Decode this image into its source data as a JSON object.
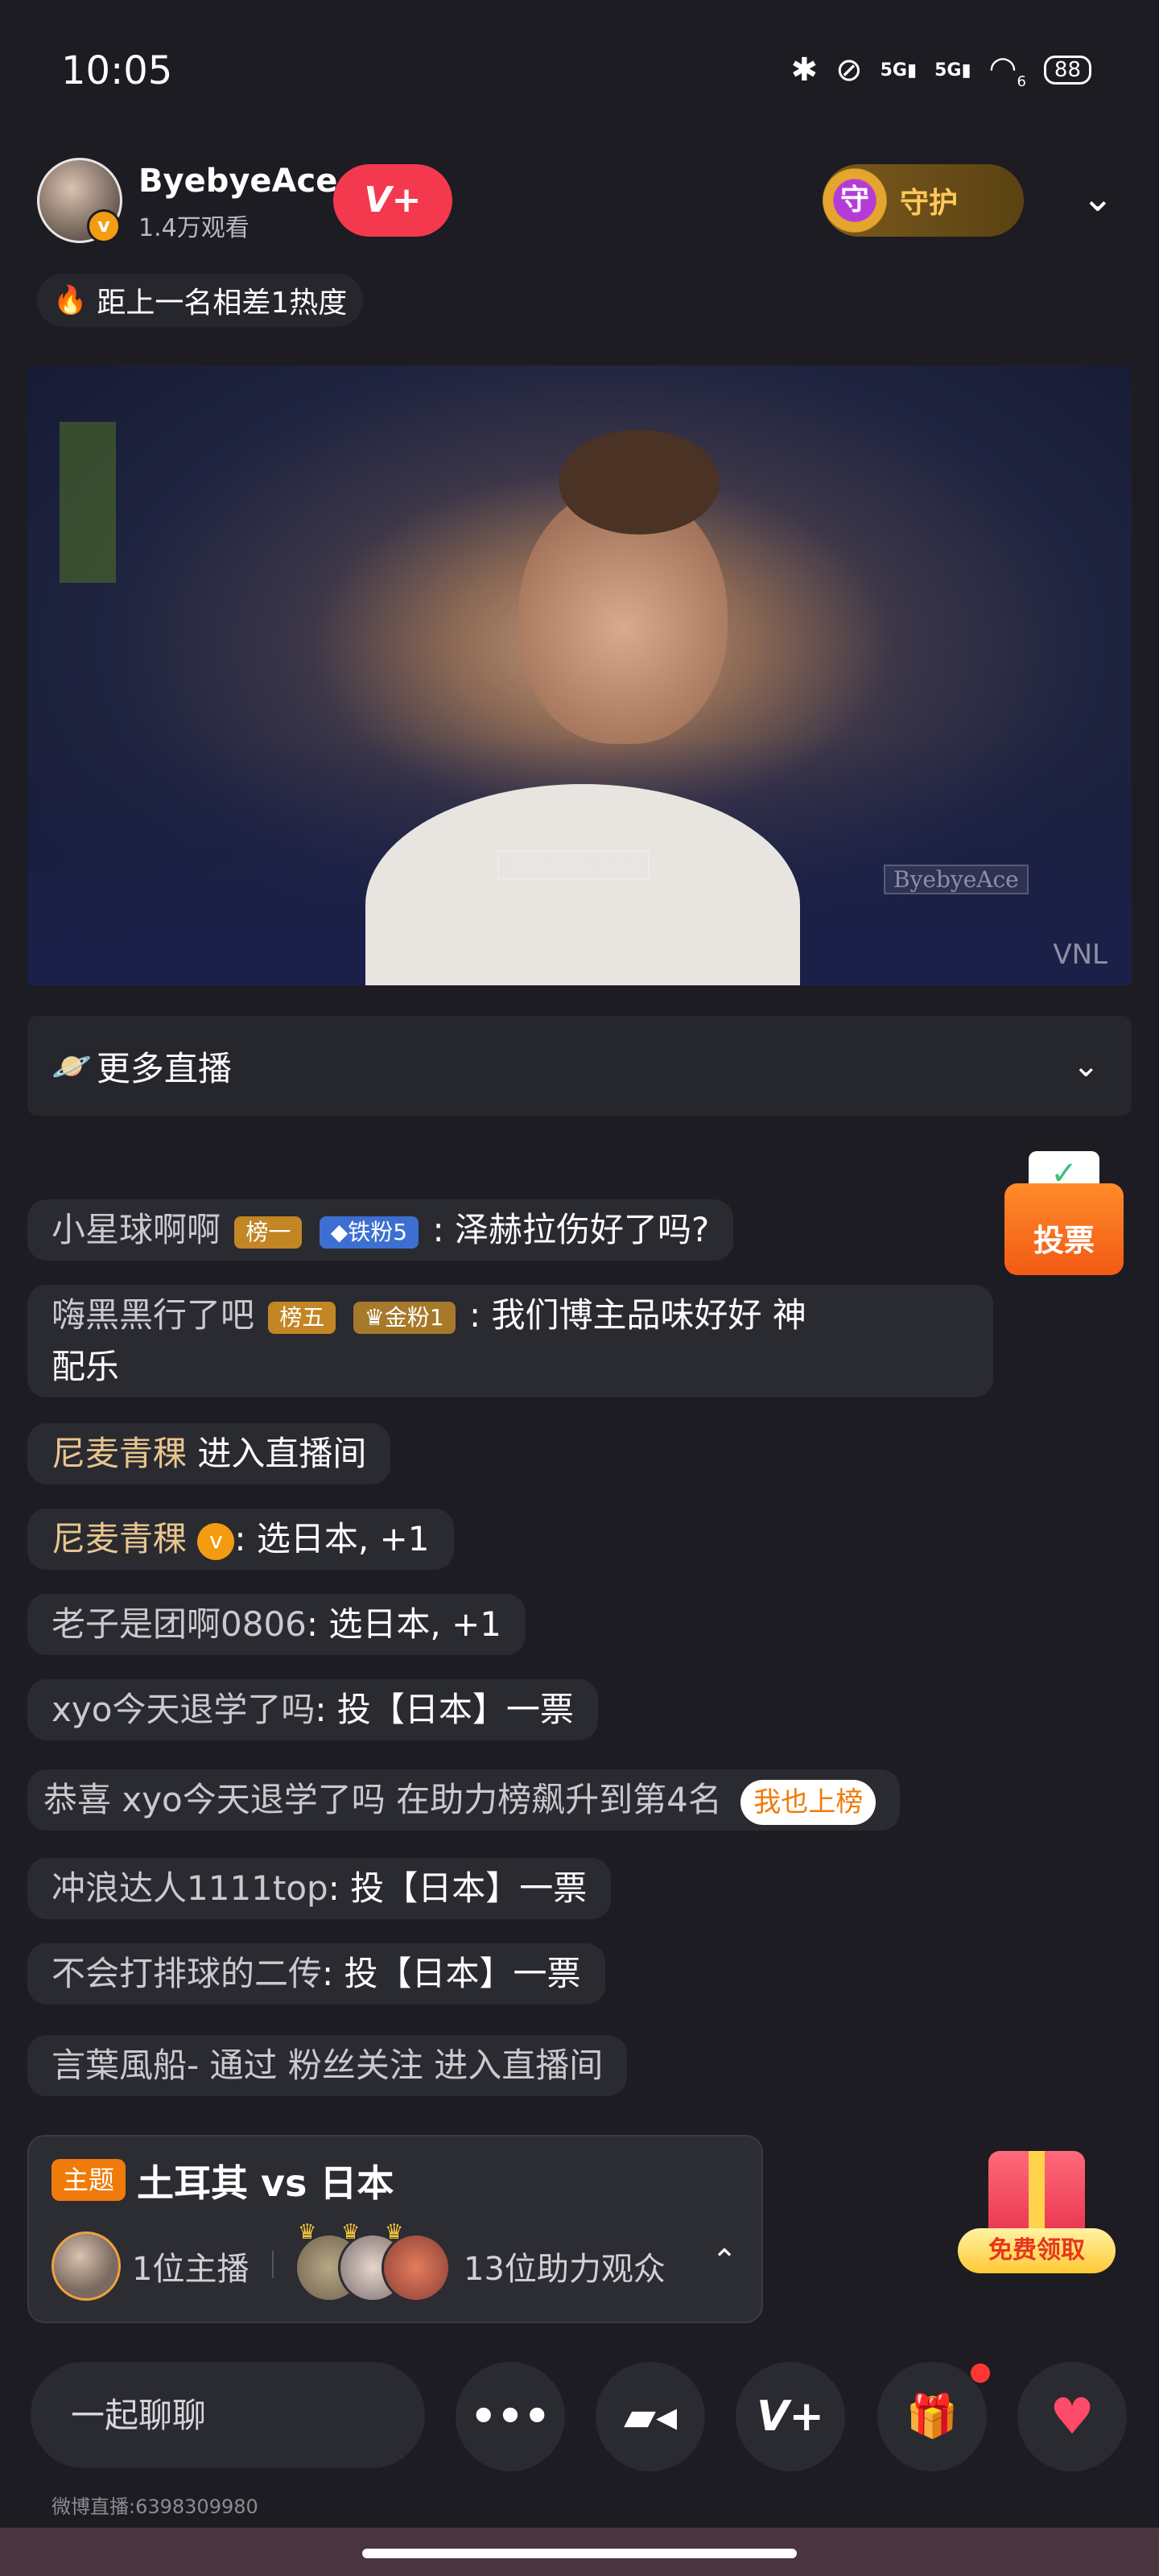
{
  "status_bar": {
    "time": "10:05",
    "battery": "88",
    "signal_1": "5G",
    "signal_2": "5G",
    "wifi_sub": "6"
  },
  "header": {
    "streamer_name": "ByebyeAce",
    "viewer_count": "1.4万观看",
    "follow_label": "V+",
    "guard_label": "守护",
    "guard_icon_glyph": "守"
  },
  "heat_notice": "距上一名相差1热度",
  "video": {
    "watermark_1": "Byebye Ace",
    "watermark_2": "ByebyeAce",
    "corner_mark": "VNL"
  },
  "more_live": {
    "label": "更多直播"
  },
  "chat_messages": [
    {
      "user": "小星球啊啊",
      "badges": [
        "榜一",
        "铁粉5"
      ],
      "text": ": 泽赫拉伤好了吗?"
    },
    {
      "user": "嗨黑黑行了吧",
      "badges": [
        "榜五",
        "金粉1"
      ],
      "text": ": 我们博主品味好好  神",
      "text_line2": "配乐"
    },
    {
      "user": "尼麦青稞",
      "text": " 进入直播间"
    },
    {
      "user": "尼麦青稞",
      "text": ": 选日本, +1"
    },
    {
      "user": "老子是团啊0806",
      "text": ": 选日本, +1"
    },
    {
      "user": "xyo今天退学了吗",
      "text": ": 投【日本】一票"
    },
    {
      "prefix": "恭喜 xyo今天退学了吗 在助力榜飙升到第4名",
      "action": "我也上榜"
    },
    {
      "user": "冲浪达人1111top",
      "text": ": 投【日本】一票"
    },
    {
      "user": "不会打排球的二传",
      "text": ": 投【日本】一票"
    },
    {
      "user": "言葉風船-",
      "text": " 通过 粉丝关注 进入直播间"
    }
  ],
  "vote_widget": {
    "label": "投票"
  },
  "topic": {
    "tag": "主题",
    "title": "土耳其 vs 日本",
    "host_count": "1位主播",
    "helper_count": "13位助力观众"
  },
  "free_gift": {
    "label": "免费领取"
  },
  "bottom_bar": {
    "chat_placeholder": "一起聊聊",
    "more_glyph": "•••",
    "v_glyph": "V+",
    "room_id": "微博直播:6398309980"
  },
  "colors": {
    "background": "#1c1c22",
    "accent_red": "#f4394e",
    "accent_orange": "#f07b0a",
    "guard_gold": "#ffc85a"
  },
  "icons": [
    "bluetooth-icon",
    "alarm-off-icon",
    "wifi-icon",
    "battery-icon",
    "chevron-down-icon",
    "flame-icon",
    "planet-icon",
    "vote-box-icon",
    "gift-icon",
    "camera-icon",
    "heart-icon",
    "more-icon"
  ]
}
